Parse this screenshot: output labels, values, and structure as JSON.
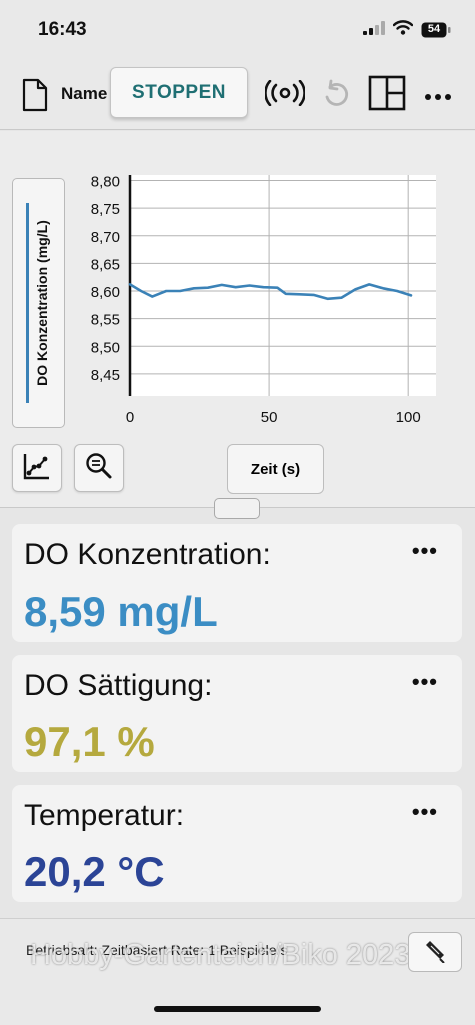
{
  "status_bar": {
    "time": "16:43",
    "battery": "54",
    "icons": [
      "signal-icon",
      "wifi-icon",
      "battery-icon"
    ]
  },
  "toolbar": {
    "name_label": "Name",
    "stop_label": "STOPPEN",
    "icons": [
      "document-icon",
      "sensor-connect-icon",
      "undo-icon",
      "layout-icon",
      "more-icon"
    ]
  },
  "graph": {
    "ylabel": "DO Konzentration (mg/L)",
    "xaxis_button_label": "Zeit (s)",
    "tool_icons": [
      "graph-tools-icon",
      "zoom-icon"
    ]
  },
  "chart_data": {
    "type": "line",
    "title": "",
    "xlabel": "Zeit (s)",
    "ylabel": "DO Konzentration (mg/L)",
    "xlim": [
      0,
      110
    ],
    "ylim": [
      8.41,
      8.81
    ],
    "x_ticks": [
      "0",
      "50",
      "100"
    ],
    "x_tick_values": [
      0,
      50,
      100
    ],
    "y_ticks": [
      "8,80",
      "8,75",
      "8,70",
      "8,65",
      "8,60",
      "8,55",
      "8,50",
      "8,45"
    ],
    "y_tick_values": [
      8.8,
      8.75,
      8.7,
      8.65,
      8.6,
      8.55,
      8.5,
      8.45
    ],
    "grid": true,
    "series": [
      {
        "color": "#3b82b7",
        "x": [
          0,
          4,
          8,
          13,
          18,
          23,
          28,
          33,
          38,
          43,
          48,
          53,
          56,
          61,
          66,
          71,
          76,
          81,
          86,
          91,
          96,
          101
        ],
        "y": [
          8.612,
          8.6,
          8.59,
          8.6,
          8.6,
          8.605,
          8.606,
          8.611,
          8.607,
          8.61,
          8.607,
          8.606,
          8.595,
          8.594,
          8.593,
          8.586,
          8.588,
          8.603,
          8.612,
          8.605,
          8.6,
          8.592
        ]
      }
    ]
  },
  "meters": [
    {
      "label": "DO Konzentration:",
      "value": "8,59 mg/L",
      "color": "#3b8dc4",
      "menu": "•••"
    },
    {
      "label": "DO Sättigung:",
      "value": "97,1 %",
      "color": "#b5a93e",
      "menu": "•••"
    },
    {
      "label": "Temperatur:",
      "value": "20,2 °C",
      "color": "#2b4496",
      "menu": "•••"
    }
  ],
  "footer": {
    "info": "Betriebsart: Zeitbasiert    Rate: 1 Beispiele/s",
    "watermark": "Hobby-Gartenteich/Biko 2023",
    "icons": [
      "sensor-probe-icon"
    ]
  }
}
